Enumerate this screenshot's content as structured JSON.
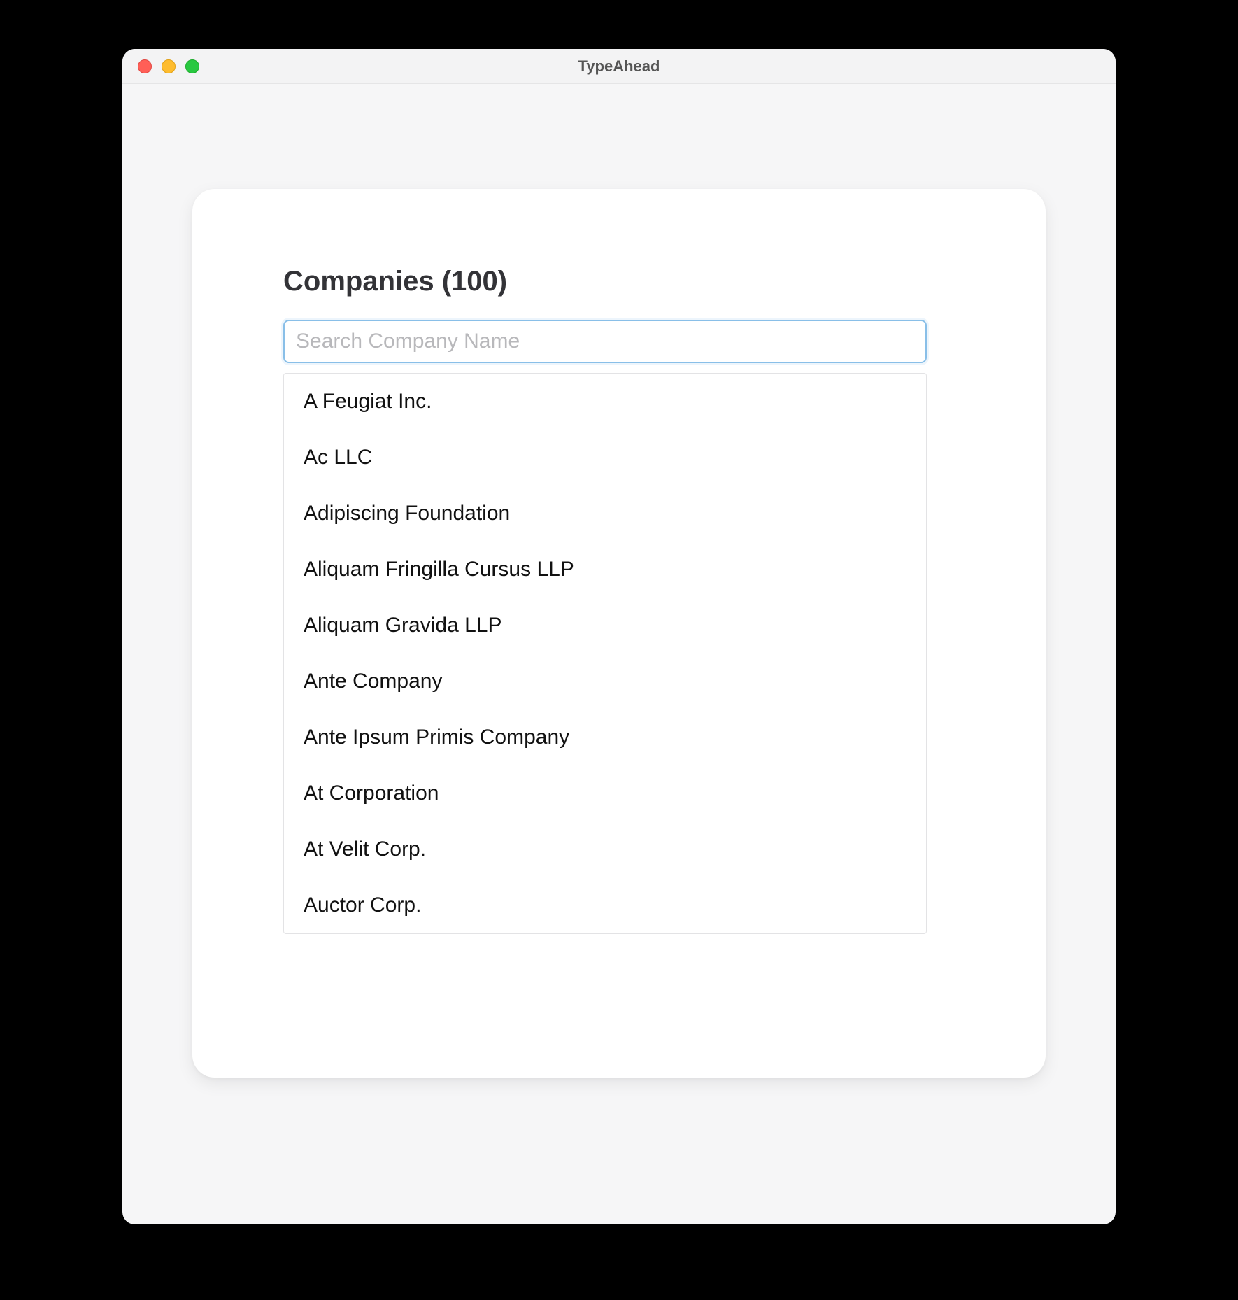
{
  "window": {
    "title": "TypeAhead"
  },
  "heading": "Companies (100)",
  "search": {
    "placeholder": "Search Company Name",
    "value": ""
  },
  "companies": [
    "A Feugiat Inc.",
    "Ac LLC",
    "Adipiscing Foundation",
    "Aliquam Fringilla Cursus LLP",
    "Aliquam Gravida LLP",
    "Ante Company",
    "Ante Ipsum Primis Company",
    "At Corporation",
    "At Velit Corp.",
    "Auctor Corp."
  ]
}
